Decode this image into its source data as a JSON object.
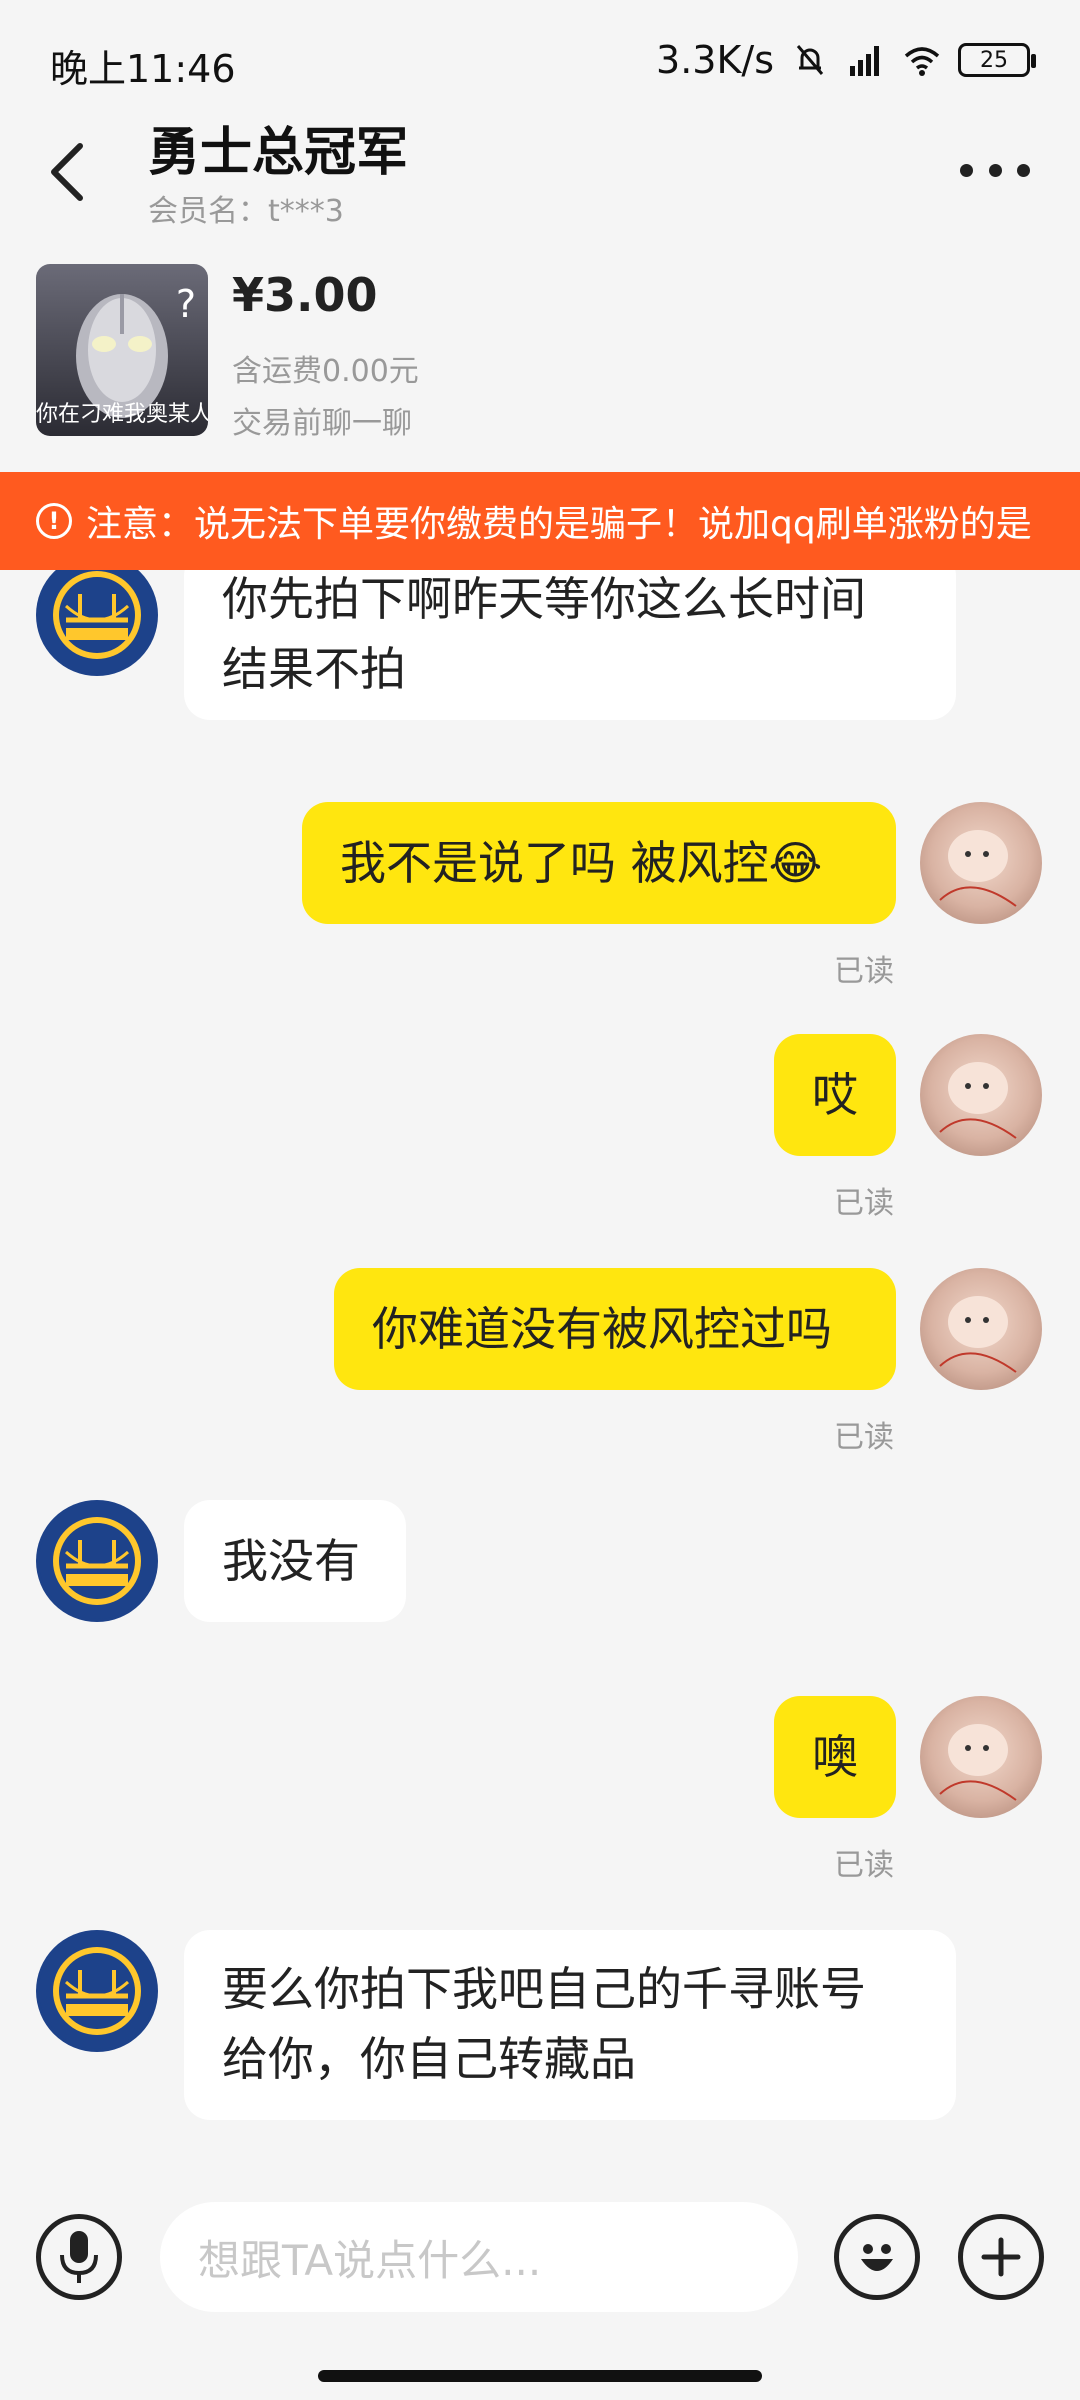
{
  "status": {
    "time": "晚上11:46",
    "speed": "3.3K/s",
    "battery": "25"
  },
  "header": {
    "title": "勇士总冠军",
    "member": "会员名：t***3"
  },
  "product": {
    "thumb_caption": "你在刁难我奥某人",
    "thumb_symbol": "?",
    "price": "¥3.00",
    "shipping": "含运费0.00元",
    "note": "交易前聊一聊"
  },
  "warning": {
    "icon": "!",
    "text": "注意：说无法下单要你缴费的是骗子！说加qq刷单涨粉的是"
  },
  "messages": [
    {
      "side": "left",
      "lines": [
        "你先拍下啊昨天等你这么长时间",
        "结果不拍"
      ]
    },
    {
      "side": "right",
      "text": "我不是说了吗 被风控😂",
      "status": "已读"
    },
    {
      "side": "right",
      "text": "哎",
      "status": "已读"
    },
    {
      "side": "right",
      "text": "你难道没有被风控过吗",
      "status": "已读"
    },
    {
      "side": "left",
      "text": "我没有"
    },
    {
      "side": "right",
      "text": "噢",
      "status": "已读"
    },
    {
      "side": "left",
      "lines": [
        "要么你拍下我吧自己的千寻账号",
        "给你，你自己转藏品"
      ]
    }
  ],
  "input": {
    "placeholder": "想跟TA说点什么..."
  },
  "icons": {
    "back": "back-arrow-icon",
    "more": "more-icon",
    "voice": "microphone-icon",
    "emoji": "emoji-icon",
    "plus": "plus-icon"
  },
  "colors": {
    "accent": "#ffe60f",
    "warning": "#ff5a1f",
    "background": "#f5f5f5"
  }
}
